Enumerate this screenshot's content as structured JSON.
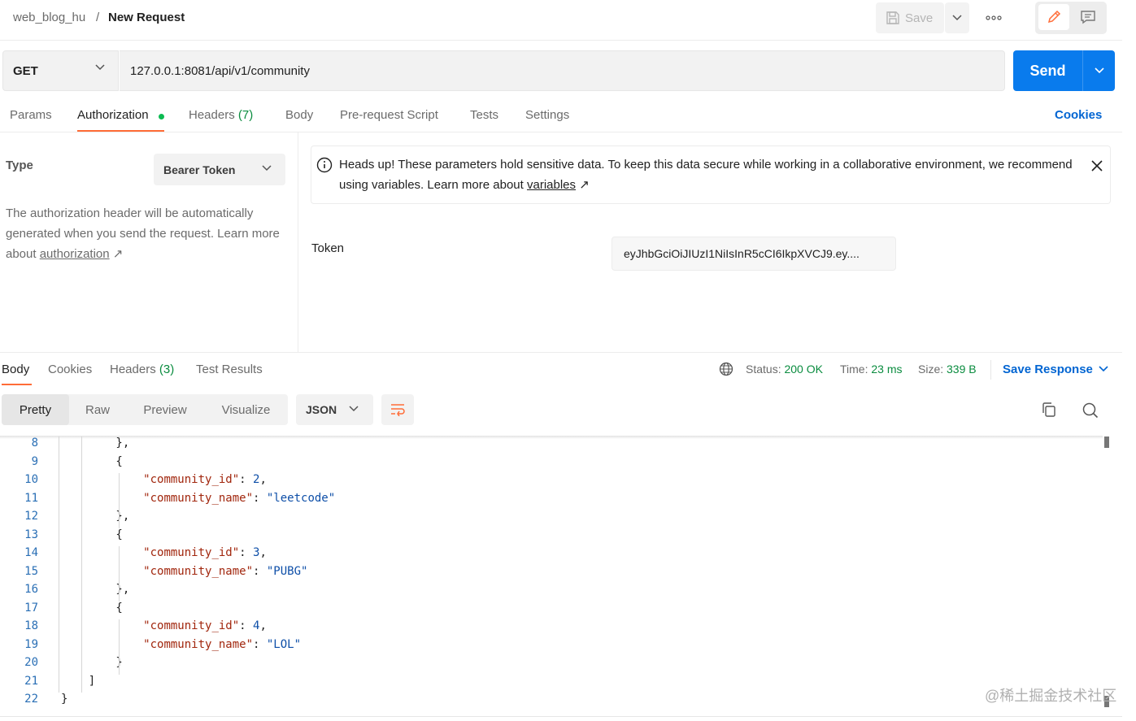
{
  "breadcrumb": {
    "workspace": "web_blog_hu",
    "separator": "/",
    "title": "New Request"
  },
  "toolbar": {
    "save_label": "Save",
    "more_icon": "ellipsis-icon",
    "edit_icon": "pencil-icon",
    "comment_icon": "comment-icon"
  },
  "request": {
    "method": "GET",
    "url": "127.0.0.1:8081/api/v1/community",
    "send_label": "Send"
  },
  "request_tabs": [
    {
      "label": "Params"
    },
    {
      "label": "Authorization",
      "active": true
    },
    {
      "label": "Headers",
      "count": "(7)"
    },
    {
      "label": "Body"
    },
    {
      "label": "Pre-request Script"
    },
    {
      "label": "Tests"
    },
    {
      "label": "Settings"
    }
  ],
  "cookies_label": "Cookies",
  "auth": {
    "type_label": "Type",
    "type_value": "Bearer Token",
    "desc_text": "The authorization header will be automatically generated when you send the request. Learn more about ",
    "desc_link": "authorization",
    "arrow": "↗",
    "warning_text": "Heads up! These parameters hold sensitive data. To keep this data secure while working in a collaborative environment, we recommend using variables. Learn more about ",
    "warning_link": "variables",
    "token_label": "Token",
    "token_value": "eyJhbGciOiJIUzI1NiIsInR5cCI6IkpXVCJ9.ey...."
  },
  "response_tabs": [
    {
      "label": "Body",
      "active": true
    },
    {
      "label": "Cookies"
    },
    {
      "label": "Headers",
      "count": "(3)"
    },
    {
      "label": "Test Results"
    }
  ],
  "response_meta": {
    "status_label": "Status:",
    "status_value": "200 OK",
    "time_label": "Time:",
    "time_value": "23 ms",
    "size_label": "Size:",
    "size_value": "339 B",
    "save_response": "Save Response"
  },
  "view_modes": [
    "Pretty",
    "Raw",
    "Preview",
    "Visualize"
  ],
  "format": "JSON",
  "code_lines": [
    {
      "n": "8",
      "t": "        },",
      "kind": "p"
    },
    {
      "n": "9",
      "t": "        {",
      "kind": "p"
    },
    {
      "n": "10",
      "k": "\"community_id\"",
      "v": "2",
      "indent": "            ",
      "tail": ","
    },
    {
      "n": "11",
      "k": "\"community_name\"",
      "v": "\"leetcode\"",
      "indent": "            ",
      "tail": ""
    },
    {
      "n": "12",
      "t": "        },",
      "kind": "p"
    },
    {
      "n": "13",
      "t": "        {",
      "kind": "p"
    },
    {
      "n": "14",
      "k": "\"community_id\"",
      "v": "3",
      "indent": "            ",
      "tail": ","
    },
    {
      "n": "15",
      "k": "\"community_name\"",
      "v": "\"PUBG\"",
      "indent": "            ",
      "tail": ""
    },
    {
      "n": "16",
      "t": "        },",
      "kind": "p"
    },
    {
      "n": "17",
      "t": "        {",
      "kind": "p"
    },
    {
      "n": "18",
      "k": "\"community_id\"",
      "v": "4",
      "indent": "            ",
      "tail": ","
    },
    {
      "n": "19",
      "k": "\"community_name\"",
      "v": "\"LOL\"",
      "indent": "            ",
      "tail": ""
    },
    {
      "n": "20",
      "t": "        }",
      "kind": "p"
    },
    {
      "n": "21",
      "t": "    ]",
      "kind": "p"
    },
    {
      "n": "22",
      "t": "}",
      "kind": "p"
    }
  ],
  "watermark": "@稀土掘金技术社区"
}
